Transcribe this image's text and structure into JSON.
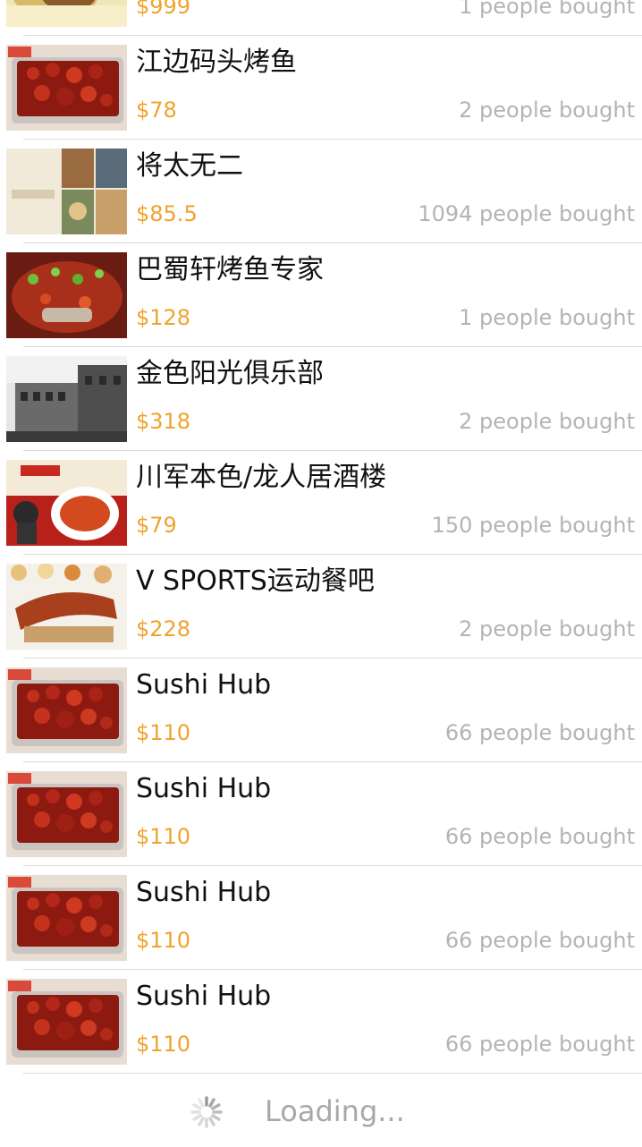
{
  "items": [
    {
      "title": "",
      "price": "$999",
      "bought": "1 people bought",
      "thumb": "food-photo"
    },
    {
      "title": "江边码头烤鱼",
      "price": "$78",
      "bought": "2 people bought",
      "thumb": "grilled-fish-photo"
    },
    {
      "title": "将太无二",
      "price": "$85.5",
      "bought": "1094 people bought",
      "thumb": "restaurant-collage-photo"
    },
    {
      "title": "巴蜀轩烤鱼专家",
      "price": "$128",
      "bought": "1 people bought",
      "thumb": "spicy-fish-photo"
    },
    {
      "title": "金色阳光俱乐部",
      "price": "$318",
      "bought": "2 people bought",
      "thumb": "building-photo"
    },
    {
      "title": "川军本色/龙人居酒楼",
      "price": "$79",
      "bought": "150 people bought",
      "thumb": "restaurant-poster-photo"
    },
    {
      "title": "V SPORTS运动餐吧",
      "price": "$228",
      "bought": "2 people bought",
      "thumb": "ribs-photo"
    },
    {
      "title": "Sushi Hub",
      "price": "$110",
      "bought": "66 people bought",
      "thumb": "grilled-fish-photo"
    },
    {
      "title": "Sushi Hub",
      "price": "$110",
      "bought": "66 people bought",
      "thumb": "grilled-fish-photo"
    },
    {
      "title": "Sushi Hub",
      "price": "$110",
      "bought": "66 people bought",
      "thumb": "grilled-fish-photo"
    },
    {
      "title": "Sushi Hub",
      "price": "$110",
      "bought": "66 people bought",
      "thumb": "grilled-fish-photo"
    }
  ],
  "loading": {
    "text": "Loading...",
    "icon": "spinner-icon"
  },
  "colors": {
    "price": "#f0a32c",
    "bought": "#b4b4b4",
    "title": "#111111",
    "separator": "#d9d9d9"
  }
}
